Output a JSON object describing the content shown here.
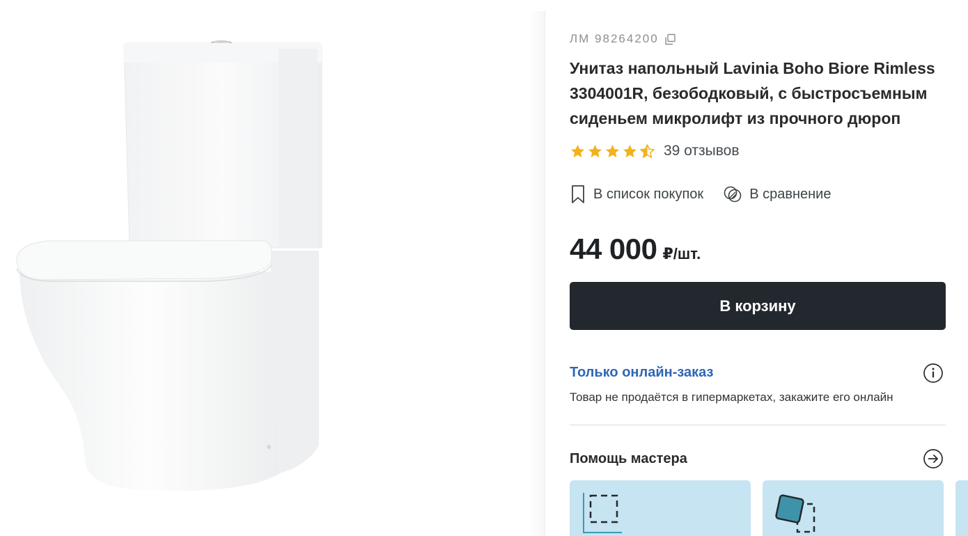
{
  "product": {
    "sku_label": "ЛМ 98264200",
    "title": "Унитаз напольный Lavinia Boho Biore Rimless 3304001R, безободковый, с быстросъемным сиденьем микролифт из прочного дюроп",
    "rating": 4.5,
    "rating_max": 5,
    "reviews_label": "39 отзывов",
    "price_value": "44 000",
    "price_unit": "₽/шт."
  },
  "actions": {
    "shopping_list_label": "В список покупок",
    "compare_label": "В сравнение"
  },
  "cart": {
    "button_label": "В корзину"
  },
  "availability": {
    "title": "Только онлайн-заказ",
    "description": "Товар не продаётся в гипермаркетах, закажите его онлайн"
  },
  "help": {
    "title": "Помощь мастера"
  },
  "colors": {
    "button_bg": "#22282d",
    "link_blue": "#2f66b6",
    "star_gold": "#f2b21b",
    "card_bg": "#c6e4f2"
  },
  "icons": [
    "copy-icon",
    "star-icon",
    "bookmark-icon",
    "compare-icon",
    "info-icon",
    "arrow-right-icon"
  ]
}
